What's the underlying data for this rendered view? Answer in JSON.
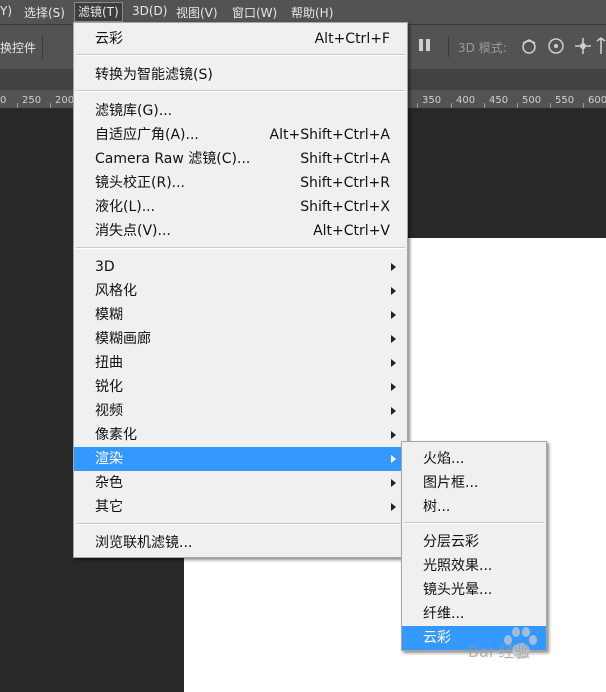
{
  "menubar": {
    "items": [
      {
        "label": "Y)"
      },
      {
        "label": "选择(S)"
      },
      {
        "label": "滤镜(T)"
      },
      {
        "label": "3D(D)"
      },
      {
        "label": "视图(V)"
      },
      {
        "label": "窗口(W)"
      },
      {
        "label": "帮助(H)"
      }
    ]
  },
  "options": {
    "left_label": "换控件",
    "mode_label": "3D 模式:"
  },
  "ruler": {
    "left": [
      "0",
      "250",
      "200"
    ],
    "right": [
      "350",
      "400",
      "450",
      "500",
      "550",
      "600"
    ]
  },
  "filter_menu": {
    "group1": [
      {
        "label": "云彩",
        "shortcut": "Alt+Ctrl+F"
      }
    ],
    "group2": [
      {
        "label": "转换为智能滤镜(S)"
      }
    ],
    "group3": [
      {
        "label": "滤镜库(G)...",
        "shortcut": ""
      },
      {
        "label": "自适应广角(A)...",
        "shortcut": "Alt+Shift+Ctrl+A"
      },
      {
        "label": "Camera Raw 滤镜(C)...",
        "shortcut": "Shift+Ctrl+A"
      },
      {
        "label": "镜头校正(R)...",
        "shortcut": "Shift+Ctrl+R"
      },
      {
        "label": "液化(L)...",
        "shortcut": "Shift+Ctrl+X"
      },
      {
        "label": "消失点(V)...",
        "shortcut": "Alt+Ctrl+V"
      }
    ],
    "group4": [
      {
        "label": "3D"
      },
      {
        "label": "风格化"
      },
      {
        "label": "模糊"
      },
      {
        "label": "模糊画廊"
      },
      {
        "label": "扭曲"
      },
      {
        "label": "锐化"
      },
      {
        "label": "视频"
      },
      {
        "label": "像素化"
      },
      {
        "label": "渲染"
      },
      {
        "label": "杂色"
      },
      {
        "label": "其它"
      }
    ],
    "group5": [
      {
        "label": "浏览联机滤镜..."
      }
    ]
  },
  "render_submenu": {
    "group1": [
      {
        "label": "火焰..."
      },
      {
        "label": "图片框..."
      },
      {
        "label": "树..."
      }
    ],
    "group2": [
      {
        "label": "分层云彩"
      },
      {
        "label": "光照效果..."
      },
      {
        "label": "镜头光晕..."
      },
      {
        "label": "纤维..."
      },
      {
        "label": "云彩"
      }
    ]
  },
  "watermark": {
    "text": "Bai 经验"
  },
  "colors": {
    "highlight": "#3399ff",
    "menu_bg": "#f0f0f0",
    "app_bg": "#282828"
  }
}
